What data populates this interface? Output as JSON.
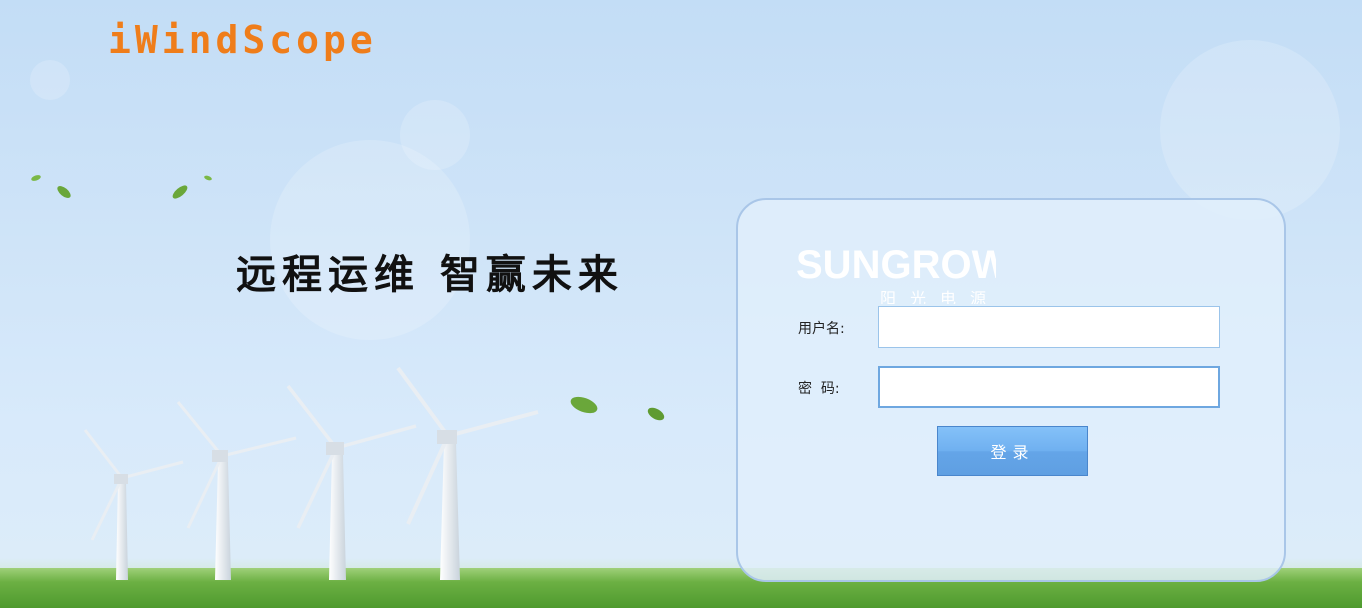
{
  "header": {
    "brand_title": "iWindScope",
    "slogan": "远程运维 智赢未来"
  },
  "login": {
    "logo_text": "SUNGROW",
    "logo_subtext": "阳光电源",
    "username_label": "用户名:",
    "username_value": "",
    "password_label": "密  码:",
    "password_value": "",
    "submit_label": "登录"
  },
  "colors": {
    "brand_orange": "#ef7d1a",
    "button_blue": "#6fb0f0",
    "panel_border": "#a9c6e8",
    "sky": "#c3ddf6",
    "grass": "#6cb043"
  }
}
